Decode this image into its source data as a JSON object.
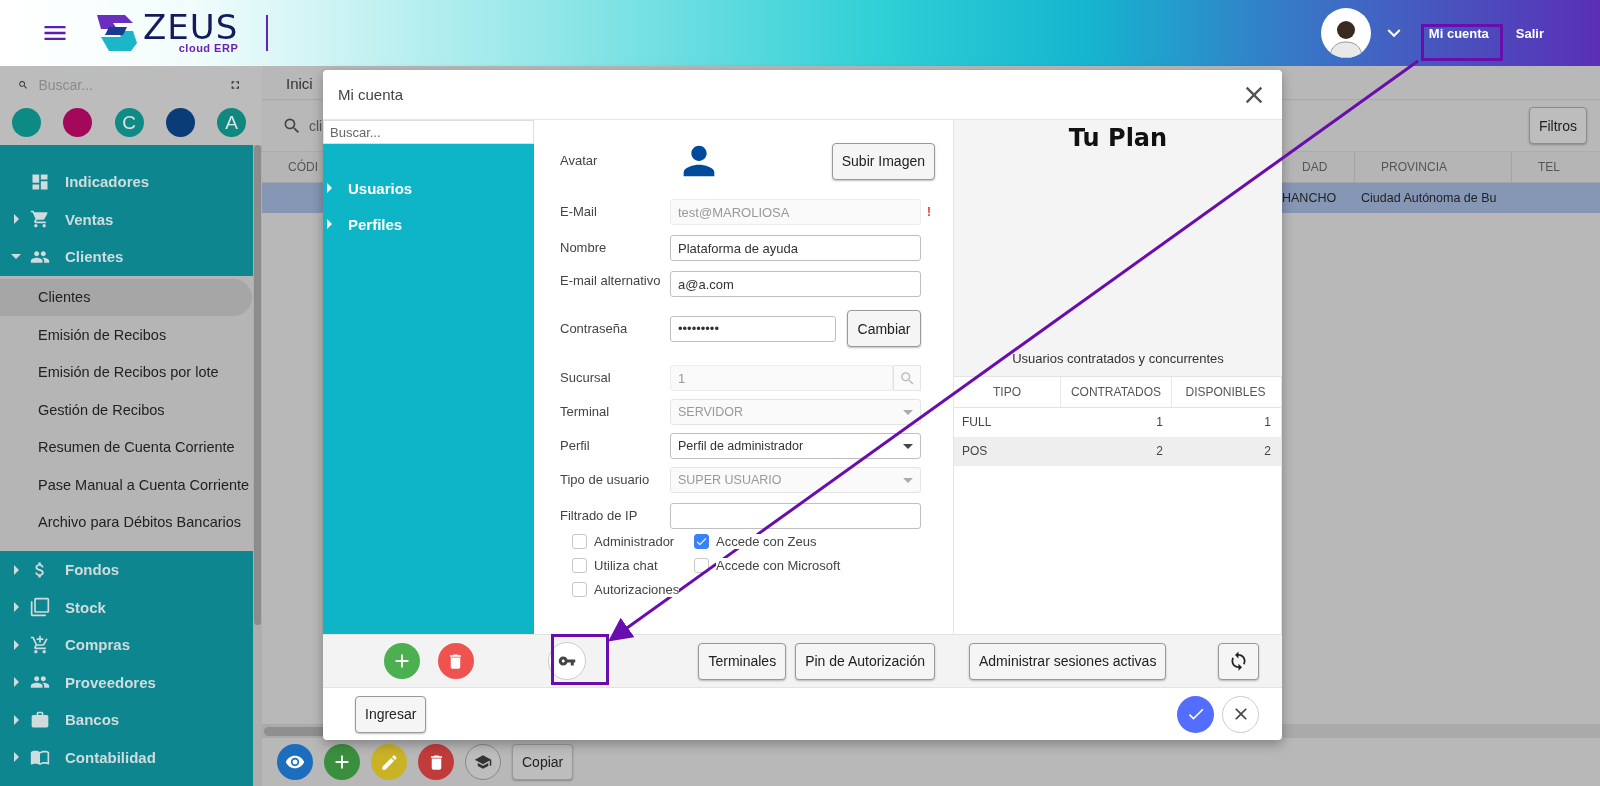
{
  "header": {
    "logo": {
      "name": "ZEUS",
      "tagline": "cloud ERP"
    },
    "account_label": "Mi cuenta",
    "logout_label": "Salir"
  },
  "sidebar": {
    "search": {
      "placeholder": "Buscar..."
    },
    "shortcuts": [
      {
        "color": "#0d8a84"
      },
      {
        "color": "#a3085a"
      },
      {
        "label": "C",
        "color": "#0f8a85"
      },
      {
        "color": "#0a3d78"
      },
      {
        "label": "A",
        "color": "#11887f"
      }
    ],
    "menu": [
      {
        "label": "Indicadores"
      },
      {
        "label": "Ventas",
        "expanded": false
      },
      {
        "label": "Clientes",
        "expanded": true,
        "children": [
          {
            "label": "Clientes",
            "selected": true
          },
          {
            "label": "Emisión de Recibos",
            "selected": false
          },
          {
            "label": "Emisión de Recibos por lote",
            "selected": false
          },
          {
            "label": "Gestión de Recibos",
            "selected": false
          },
          {
            "label": "Resumen de Cuenta Corriente",
            "selected": false
          },
          {
            "label": "Pase Manual a Cuenta Corriente",
            "selected": false
          },
          {
            "label": "Archivo para Débitos Bancarios",
            "selected": false
          }
        ]
      },
      {
        "label": "Fondos",
        "expanded": false
      },
      {
        "label": "Stock",
        "expanded": false
      },
      {
        "label": "Compras",
        "expanded": false
      },
      {
        "label": "Proveedores",
        "expanded": false
      },
      {
        "label": "Bancos",
        "expanded": false
      },
      {
        "label": "Contabilidad",
        "expanded": false
      }
    ]
  },
  "main": {
    "tab": {
      "label": "Inici"
    },
    "search": {
      "value": "cli"
    },
    "filter_button": "Filtros",
    "table": {
      "columns": [
        "CÓDI",
        "DAD",
        "PROVINCIA",
        "TEL"
      ],
      "rows": [
        {
          "column_2": "HANCHO",
          "column_3": "Ciudad Autónoma de Bu",
          "selected": true
        }
      ]
    },
    "copy_button": "Copiar"
  },
  "dialog": {
    "title": "Mi cuenta",
    "search": {
      "placeholder": "Buscar..."
    },
    "tree": [
      {
        "label": "Usuarios",
        "expanded": false
      },
      {
        "label": "Perfiles",
        "expanded": false
      }
    ],
    "form": {
      "avatar_label": "Avatar",
      "upload_button": "Subir Imagen",
      "fields": [
        {
          "kind": "text",
          "label": "E-Mail",
          "value": "test@MAROLIOSA",
          "disabled": true,
          "required_mark": "!"
        },
        {
          "kind": "text",
          "label": "Nombre",
          "value": "Plataforma de ayuda",
          "disabled": false
        },
        {
          "kind": "text",
          "label": "E-mail alternativo",
          "value": "a@a.com",
          "disabled": false
        },
        {
          "kind": "password",
          "label": "Contraseña",
          "value": "•••••••••",
          "disabled": false,
          "button": "Cambiar"
        },
        {
          "kind": "lookup",
          "label": "Sucursal",
          "value": "1",
          "disabled": true
        },
        {
          "kind": "select",
          "label": "Terminal",
          "value": "SERVIDOR",
          "disabled": true
        },
        {
          "kind": "select",
          "label": "Perfil",
          "value": "Perfil de administrador",
          "disabled": false
        },
        {
          "kind": "select",
          "label": "Tipo de usuario",
          "value": "SUPER USUARIO",
          "disabled": true
        },
        {
          "kind": "text",
          "label": "Filtrado de IP",
          "disabled": false
        }
      ],
      "checkboxes": [
        {
          "label": "Administrador",
          "checked": false
        },
        {
          "label": "Accede con Zeus",
          "checked": true
        },
        {
          "label": "Utiliza chat",
          "checked": false
        },
        {
          "label": "Accede con Microsoft",
          "checked": false
        },
        {
          "label": "Autorizaciones",
          "checked": false
        }
      ],
      "buttons": [
        "Terminales",
        "Pin de Autorización"
      ]
    },
    "plan": {
      "title": "Tu Plan",
      "subtitle": "Usuarios contratados y concurrentes",
      "columns": [
        "TIPO",
        "CONTRATADOS",
        "DISPONIBLES"
      ],
      "rows": [
        [
          "FULL",
          "1",
          "1"
        ],
        [
          "POS",
          "2",
          "2"
        ]
      ],
      "manage_button": "Administrar sesiones activas"
    },
    "footer": {
      "enter_button": "Ingresar"
    }
  }
}
